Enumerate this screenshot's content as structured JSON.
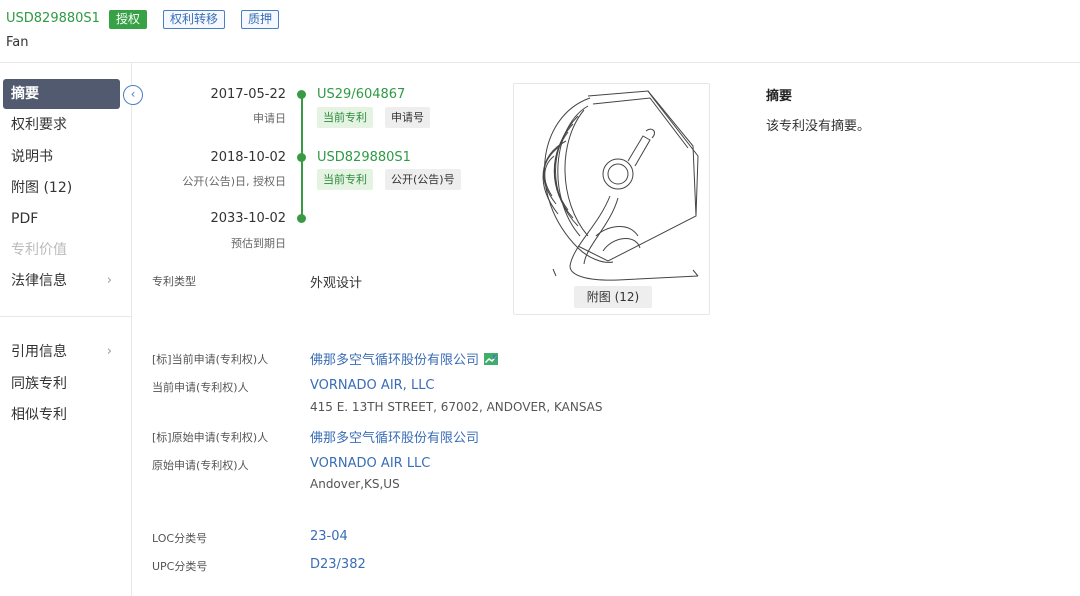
{
  "header": {
    "patent_number": "USD829880S1",
    "tags": [
      "授权",
      "权利转移",
      "质押"
    ],
    "title": "Fan"
  },
  "sidebar": {
    "collapse_icon": "chevron-left-icon",
    "items": [
      {
        "label": "摘要",
        "active": true
      },
      {
        "label": "权利要求"
      },
      {
        "label": "说明书"
      },
      {
        "label": "附图 (12)"
      },
      {
        "label": "PDF"
      },
      {
        "label": "专利价值",
        "disabled": true
      },
      {
        "label": "法律信息",
        "chevron": "›"
      },
      {
        "label": "引用信息",
        "chevron": "›"
      },
      {
        "label": "同族专利"
      },
      {
        "label": "相似专利"
      }
    ]
  },
  "timeline": [
    {
      "date": "2017-05-22",
      "label": "申请日",
      "number": "US29/604867",
      "chips": [
        "当前专利",
        "申请号"
      ]
    },
    {
      "date": "2018-10-02",
      "label": "公开(公告)日, 授权日",
      "number": "USD829880S1",
      "chips": [
        "当前专利",
        "公开(公告)号"
      ]
    },
    {
      "date": "2033-10-02",
      "label": "预估到期日"
    }
  ],
  "info": {
    "patent_type_label": "专利类型",
    "patent_type_value": "外观设计",
    "std_current_applicant_label": "[标]当前申请(专利权)人",
    "std_current_applicant_value": "佛那多空气循环股份有限公司",
    "current_applicant_label": "当前申请(专利权)人",
    "current_applicant_value": "VORNADO AIR, LLC",
    "current_applicant_address": "415 E. 13TH STREET, 67002, ANDOVER, KANSAS",
    "std_original_applicant_label": "[标]原始申请(专利权)人",
    "std_original_applicant_value": "佛那多空气循环股份有限公司",
    "original_applicant_label": "原始申请(专利权)人",
    "original_applicant_value": "VORNADO AIR LLC",
    "original_applicant_address": "Andover,KS,US",
    "loc_label": "LOC分类号",
    "loc_value": "23-04",
    "upc_label": "UPC分类号",
    "upc_value": "D23/382"
  },
  "drawing": {
    "button_label": "附图 (12)"
  },
  "abstract": {
    "title": "摘要",
    "text": "该专利没有摘要。"
  },
  "colors": {
    "green": "#37a146",
    "link_blue": "#3a6db5",
    "active_nav": "#515a6e"
  }
}
